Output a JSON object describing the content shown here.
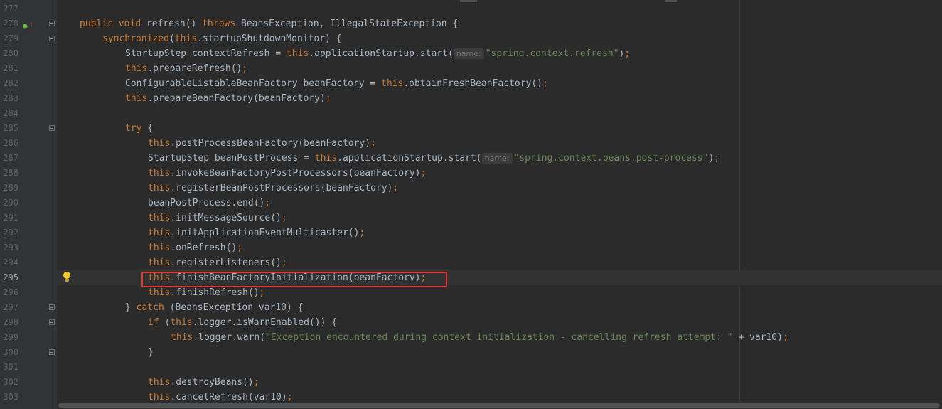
{
  "editor": {
    "language": "Java",
    "highlighted_line": "295",
    "lines": [
      {
        "num": "277",
        "tokens": []
      },
      {
        "num": "278",
        "tokens": [
          [
            "kw",
            "public "
          ],
          [
            "kw",
            "void "
          ],
          [
            "p",
            "refresh() "
          ],
          [
            "kw",
            "throws "
          ],
          [
            "p",
            "BeansException, IllegalStateException {"
          ]
        ]
      },
      {
        "num": "279",
        "tokens": [
          [
            "kw",
            "synchronized"
          ],
          [
            "p",
            "("
          ],
          [
            "kw",
            "this"
          ],
          [
            "p",
            ".startupShutdownMonitor) {"
          ]
        ]
      },
      {
        "num": "280",
        "tokens": [
          [
            "p",
            "StartupStep contextRefresh = "
          ],
          [
            "kw",
            "this"
          ],
          [
            "p",
            ".applicationStartup.start("
          ],
          [
            "hint",
            "name:"
          ],
          [
            "str",
            "\"spring.context.refresh\""
          ],
          [
            "p",
            ")"
          ],
          [
            "kw",
            ";"
          ]
        ]
      },
      {
        "num": "281",
        "tokens": [
          [
            "kw",
            "this"
          ],
          [
            "p",
            ".prepareRefresh()"
          ],
          [
            "kw",
            ";"
          ]
        ]
      },
      {
        "num": "282",
        "tokens": [
          [
            "p",
            "ConfigurableListableBeanFactory beanFactory = "
          ],
          [
            "kw",
            "this"
          ],
          [
            "p",
            ".obtainFreshBeanFactory()"
          ],
          [
            "kw",
            ";"
          ]
        ]
      },
      {
        "num": "283",
        "tokens": [
          [
            "kw",
            "this"
          ],
          [
            "p",
            ".prepareBeanFactory(beanFactory)"
          ],
          [
            "kw",
            ";"
          ]
        ]
      },
      {
        "num": "284",
        "tokens": []
      },
      {
        "num": "285",
        "tokens": [
          [
            "kw",
            "try "
          ],
          [
            "p",
            "{"
          ]
        ]
      },
      {
        "num": "286",
        "tokens": [
          [
            "kw",
            "this"
          ],
          [
            "p",
            ".postProcessBeanFactory(beanFactory)"
          ],
          [
            "kw",
            ";"
          ]
        ]
      },
      {
        "num": "287",
        "tokens": [
          [
            "p",
            "StartupStep beanPostProcess = "
          ],
          [
            "kw",
            "this"
          ],
          [
            "p",
            ".applicationStartup.start("
          ],
          [
            "hint",
            "name:"
          ],
          [
            "str",
            "\"spring.context.beans.post-process\""
          ],
          [
            "p",
            ")"
          ],
          [
            "kw",
            ";"
          ]
        ]
      },
      {
        "num": "288",
        "tokens": [
          [
            "kw",
            "this"
          ],
          [
            "p",
            ".invokeBeanFactoryPostProcessors(beanFactory)"
          ],
          [
            "kw",
            ";"
          ]
        ]
      },
      {
        "num": "289",
        "tokens": [
          [
            "kw",
            "this"
          ],
          [
            "p",
            ".registerBeanPostProcessors(beanFactory)"
          ],
          [
            "kw",
            ";"
          ]
        ]
      },
      {
        "num": "290",
        "tokens": [
          [
            "p",
            "beanPostProcess.end()"
          ],
          [
            "kw",
            ";"
          ]
        ]
      },
      {
        "num": "291",
        "tokens": [
          [
            "kw",
            "this"
          ],
          [
            "p",
            ".initMessageSource()"
          ],
          [
            "kw",
            ";"
          ]
        ]
      },
      {
        "num": "292",
        "tokens": [
          [
            "kw",
            "this"
          ],
          [
            "p",
            ".initApplicationEventMulticaster()"
          ],
          [
            "kw",
            ";"
          ]
        ]
      },
      {
        "num": "293",
        "tokens": [
          [
            "kw",
            "this"
          ],
          [
            "p",
            ".onRefresh()"
          ],
          [
            "kw",
            ";"
          ]
        ]
      },
      {
        "num": "294",
        "tokens": [
          [
            "kw",
            "this"
          ],
          [
            "p",
            ".registerListeners()"
          ],
          [
            "kw",
            ";"
          ]
        ]
      },
      {
        "num": "295",
        "tokens": [
          [
            "kw",
            "this"
          ],
          [
            "p",
            ".finishBeanFactoryInitialization(beanFactory)"
          ],
          [
            "kw",
            ";"
          ]
        ]
      },
      {
        "num": "296",
        "tokens": [
          [
            "kw",
            "this"
          ],
          [
            "p",
            ".finishRefresh()"
          ],
          [
            "kw",
            ";"
          ]
        ]
      },
      {
        "num": "297",
        "tokens": [
          [
            "p",
            "} "
          ],
          [
            "kw",
            "catch "
          ],
          [
            "p",
            "(BeansException var10) {"
          ]
        ]
      },
      {
        "num": "298",
        "tokens": [
          [
            "kw",
            "if "
          ],
          [
            "p",
            "("
          ],
          [
            "kw",
            "this"
          ],
          [
            "p",
            ".logger.isWarnEnabled()) {"
          ]
        ]
      },
      {
        "num": "299",
        "tokens": [
          [
            "kw",
            "this"
          ],
          [
            "p",
            ".logger.warn("
          ],
          [
            "str",
            "\"Exception encountered during context initialization - cancelling refresh attempt: \""
          ],
          [
            "p",
            " + var10)"
          ],
          [
            "kw",
            ";"
          ]
        ]
      },
      {
        "num": "300",
        "tokens": [
          [
            "p",
            "}"
          ]
        ]
      },
      {
        "num": "301",
        "tokens": []
      },
      {
        "num": "302",
        "tokens": [
          [
            "kw",
            "this"
          ],
          [
            "p",
            ".destroyBeans()"
          ],
          [
            "kw",
            ";"
          ]
        ]
      },
      {
        "num": "303",
        "tokens": [
          [
            "kw",
            "this"
          ],
          [
            "p",
            ".cancelRefresh(var10)"
          ],
          [
            "kw",
            ";"
          ]
        ]
      }
    ]
  },
  "colors": {
    "background": "#2b2b2b",
    "keyword": "#cc7832",
    "string": "#6a8759",
    "plain": "#a9b7c6",
    "highlight_box": "#e53935"
  },
  "gutter_icons": {
    "line_278": "implementing-method-icon",
    "line_295": "lightbulb-intention-icon"
  }
}
